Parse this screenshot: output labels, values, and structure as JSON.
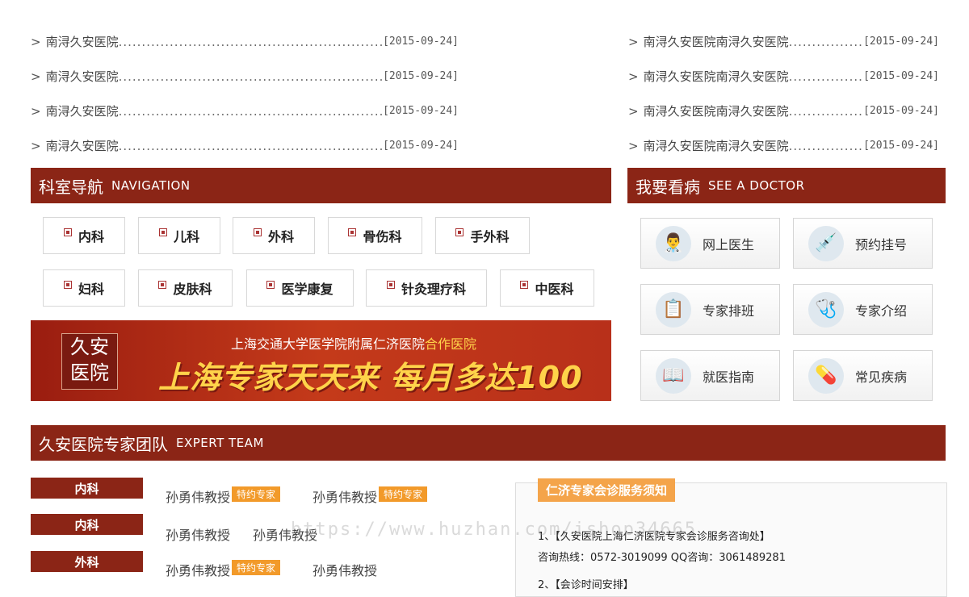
{
  "news": {
    "left": [
      {
        "title": "南浔久安医院",
        "date": "[2015-09-24]"
      },
      {
        "title": "南浔久安医院",
        "date": "[2015-09-24]"
      },
      {
        "title": "南浔久安医院",
        "date": "[2015-09-24]"
      },
      {
        "title": "南浔久安医院",
        "date": "[2015-09-24]"
      }
    ],
    "right": [
      {
        "title": "南浔久安医院南浔久安医院",
        "date": "[2015-09-24]"
      },
      {
        "title": "南浔久安医院南浔久安医院",
        "date": "[2015-09-24]"
      },
      {
        "title": "南浔久安医院南浔久安医院",
        "date": "[2015-09-24]"
      },
      {
        "title": "南浔久安医院南浔久安医院",
        "date": "[2015-09-24]"
      }
    ],
    "arrow": ">",
    "dots": "...................................................................."
  },
  "nav_bar": {
    "cn": "科室导航",
    "en": "NAVIGATION"
  },
  "departments": [
    "内科",
    "儿科",
    "外科",
    "骨伤科",
    "手外科",
    "妇科",
    "皮肤科",
    "医学康复",
    "针灸理疗科",
    "中医科"
  ],
  "banner": {
    "logo_line1": "久安",
    "logo_line2": "医院",
    "sub_prefix": "上海交通大学医学院附属仁济医院",
    "sub_highlight": "合作医院",
    "main": "上海专家天天来 每月多达100人"
  },
  "doctor_bar": {
    "cn": "我要看病",
    "en": "SEE A DOCTOR"
  },
  "doctor_buttons": [
    {
      "label": "网上医生",
      "icon": "doctor-icon",
      "glyph": "👨‍⚕️"
    },
    {
      "label": "预约挂号",
      "icon": "syringe-icon",
      "glyph": "💉"
    },
    {
      "label": "专家排班",
      "icon": "clipboard-icon",
      "glyph": "📋"
    },
    {
      "label": "专家介绍",
      "icon": "expert-icon",
      "glyph": "🩺"
    },
    {
      "label": "就医指南",
      "icon": "guide-book-icon",
      "glyph": "📖"
    },
    {
      "label": "常见疾病",
      "icon": "medicine-icon",
      "glyph": "💊"
    }
  ],
  "expert_bar": {
    "cn": "久安医院专家团队",
    "en": "EXPERT TEAM"
  },
  "expert_rows": [
    {
      "category": "内科",
      "experts": [
        {
          "name": "孙勇伟教授",
          "badge": "特约专家"
        },
        {
          "name": "孙勇伟教授",
          "badge": "特约专家"
        }
      ]
    },
    {
      "category": "内科",
      "experts": [
        {
          "name": "孙勇伟教授",
          "badge": ""
        },
        {
          "name": "孙勇伟教授",
          "badge": ""
        }
      ]
    },
    {
      "category": "外科",
      "experts": [
        {
          "name": "孙勇伟教授",
          "badge": "特约专家"
        },
        {
          "name": "孙勇伟教授",
          "badge": ""
        }
      ]
    }
  ],
  "notice": {
    "title": "仁济专家会诊服务须知",
    "line1": "1、【久安医院上海仁济医院专家会诊服务咨询处】",
    "line2": "咨询热线：0572-3019099 QQ咨询：3061489281",
    "line3": "2、【会诊时间安排】"
  },
  "watermark": "https://www.huzhan.com/ishop34665"
}
